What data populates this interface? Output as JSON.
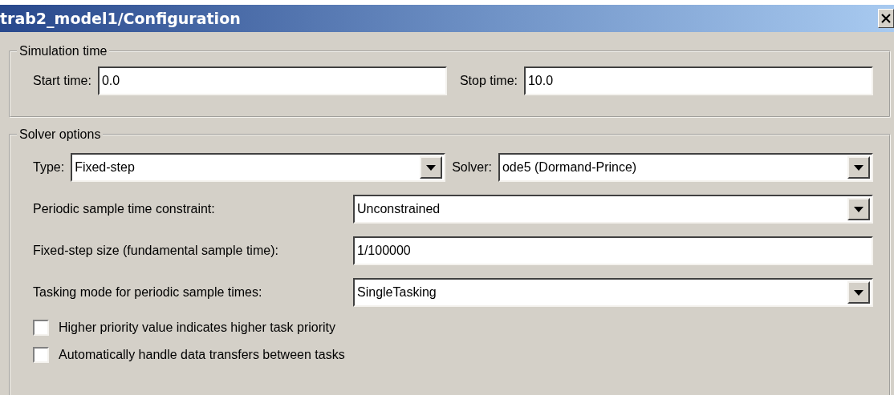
{
  "window": {
    "title": "trab2_model1/Configuration"
  },
  "simulation_time": {
    "legend": "Simulation time",
    "fields": [
      {
        "label": "Start time:",
        "value": "0.0"
      },
      {
        "label": "Stop time:",
        "value": "10.0"
      }
    ]
  },
  "solver_options": {
    "legend": "Solver options",
    "top_row": [
      {
        "label": "Type:",
        "value": "Fixed-step"
      },
      {
        "label": "Solver:",
        "value": "ode5 (Dormand-Prince)"
      }
    ],
    "rows": [
      {
        "kind": "dropdown",
        "label": "Periodic sample time constraint:",
        "value": "Unconstrained"
      },
      {
        "kind": "text",
        "label": "Fixed-step size (fundamental sample time):",
        "value": "1/100000"
      },
      {
        "kind": "dropdown",
        "label": "Tasking mode for periodic sample times:",
        "value": "SingleTasking"
      }
    ],
    "checkboxes": [
      {
        "label": "Higher priority value indicates higher task priority",
        "checked": false
      },
      {
        "label": "Automatically handle data transfers between tasks",
        "checked": false
      }
    ]
  }
}
